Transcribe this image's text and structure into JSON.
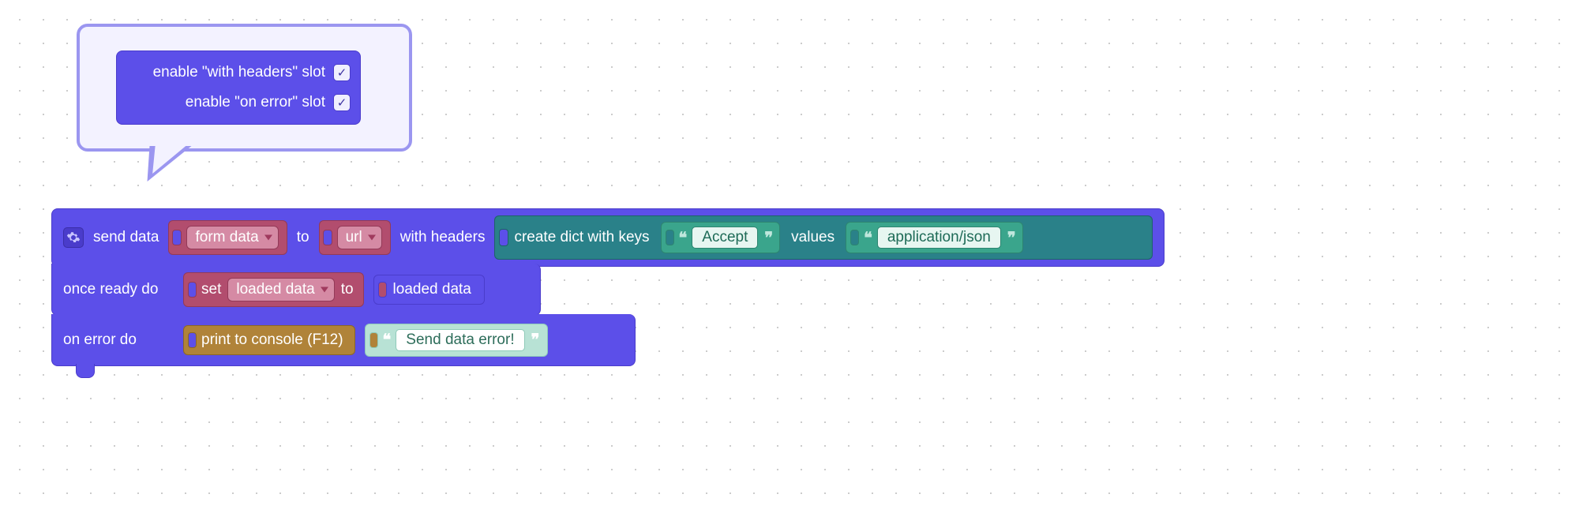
{
  "mutator": {
    "opt1_label": "enable \"with headers\" slot",
    "opt2_label": "enable \"on error\" slot",
    "checkmark": "✓"
  },
  "block": {
    "send_data": "send data",
    "form_data": "form data",
    "to": "to",
    "url": "url",
    "with_headers": "with headers",
    "dict_label": "create dict with keys",
    "accept": "Accept",
    "values": "values",
    "app_json": "application/json",
    "once_ready": "once ready do",
    "set": "set",
    "loaded_data": "loaded data",
    "to2": "to",
    "loaded_data_val": "loaded data",
    "on_error": "on error do",
    "print": "print to console (F12)",
    "err_msg": "Send data error!"
  }
}
